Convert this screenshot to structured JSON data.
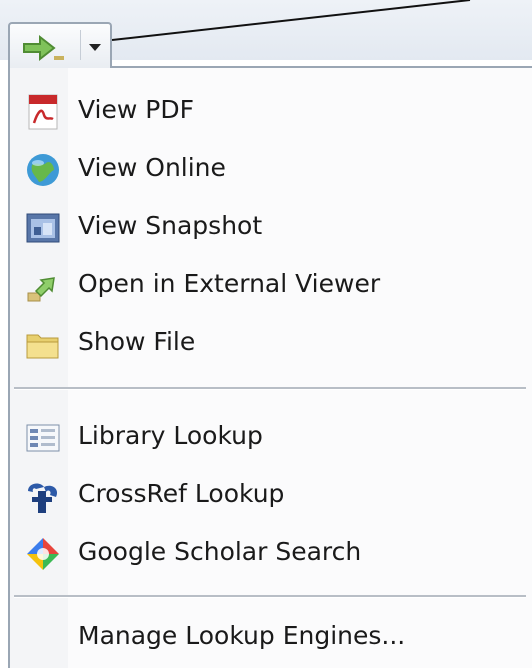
{
  "toolbar": {
    "locate_button_icon": "green-arrow-icon",
    "dropdown_icon": "chevron-down-icon"
  },
  "menu": {
    "groups": [
      {
        "items": [
          {
            "label": "View PDF",
            "icon": "pdf-icon"
          },
          {
            "label": "View Online",
            "icon": "globe-icon"
          },
          {
            "label": "View Snapshot",
            "icon": "snapshot-icon"
          },
          {
            "label": "Open in External Viewer",
            "icon": "external-viewer-icon"
          },
          {
            "label": "Show File",
            "icon": "folder-icon"
          }
        ]
      },
      {
        "items": [
          {
            "label": "Library Lookup",
            "icon": "library-icon"
          },
          {
            "label": "CrossRef Lookup",
            "icon": "crossref-icon"
          },
          {
            "label": "Google Scholar Search",
            "icon": "google-scholar-icon"
          }
        ]
      },
      {
        "items": [
          {
            "label": "Manage Lookup Engines..."
          }
        ]
      }
    ]
  }
}
